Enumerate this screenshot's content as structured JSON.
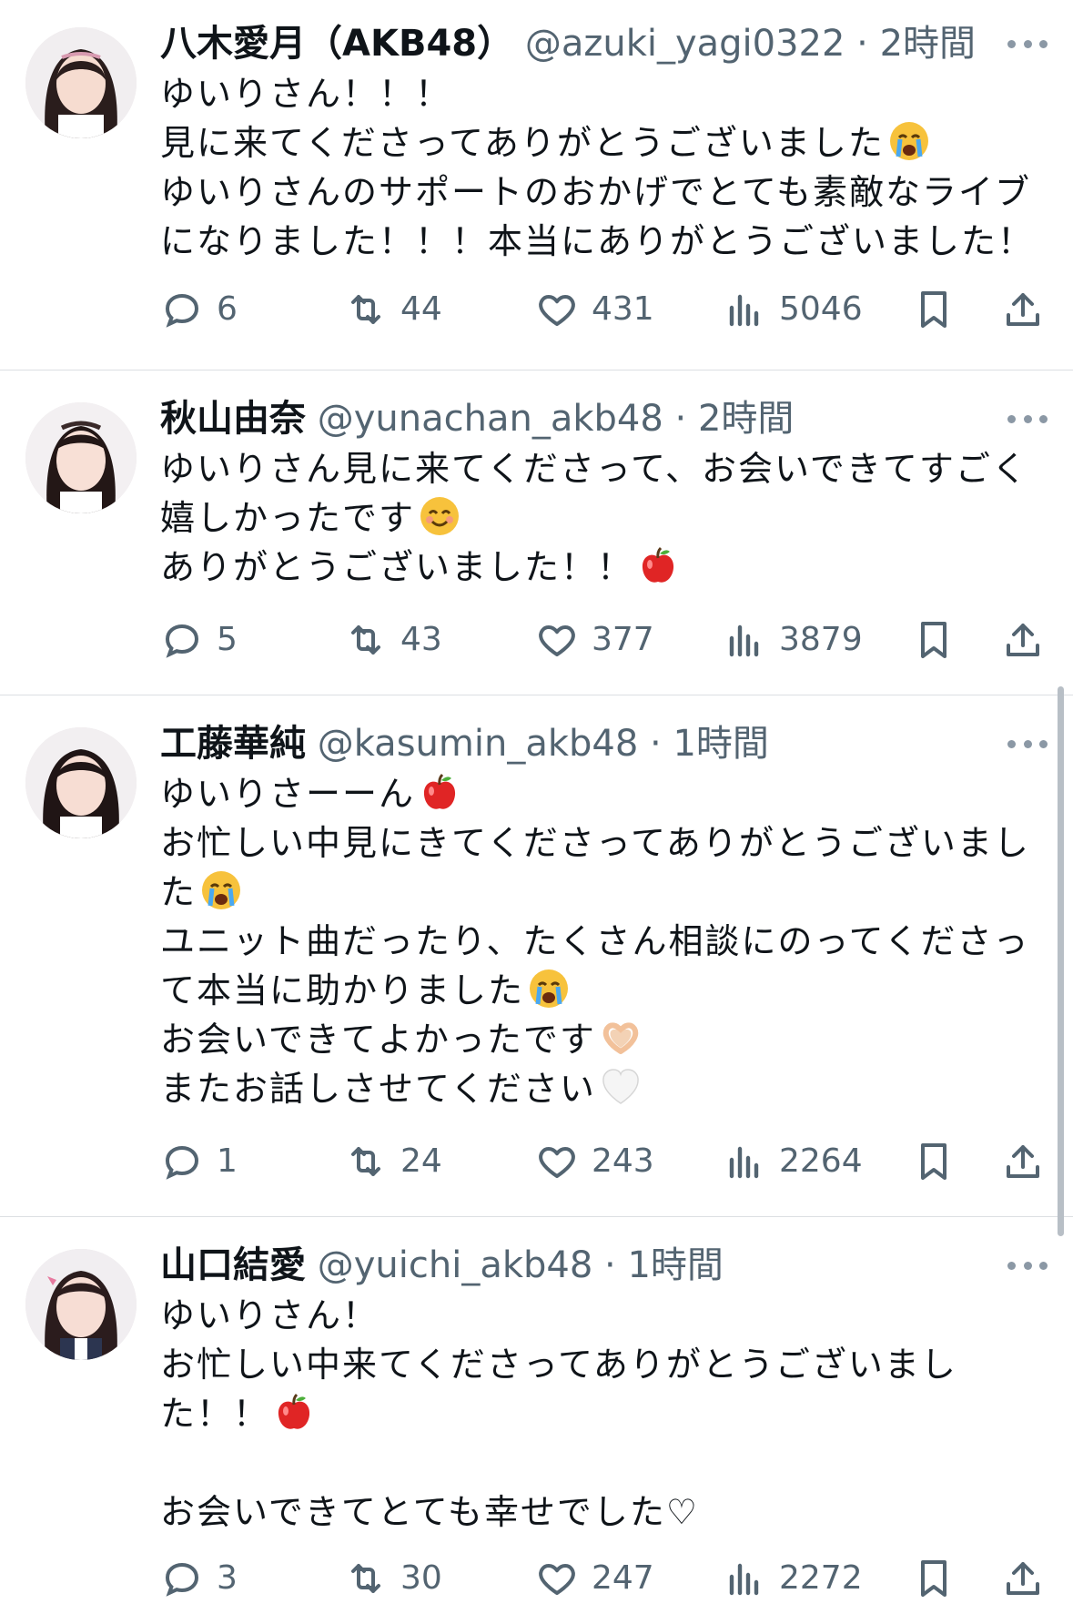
{
  "tweets": [
    {
      "name": "八木愛月（AKB48）",
      "handle": "@azuki_yagi0322",
      "time": "2時間",
      "lines": [
        "ゆいりさん！！！",
        "見に来てくださってありがとうございました",
        "ゆいりさんのサポートのおかげでとても素敵なライブ",
        "になりました！！！本当にありがとうございました！"
      ],
      "emojis": [
        "crying-face",
        "",
        "",
        ""
      ],
      "replies": "6",
      "retweets": "44",
      "likes": "431",
      "views": "5046"
    },
    {
      "name": "秋山由奈",
      "handle": "@yunachan_akb48",
      "time": "2時間",
      "lines": [
        "ゆいりさん見に来てくださって、お会いできてすごく",
        "嬉しかったです",
        "ありがとうございました！！"
      ],
      "emojis": [
        "",
        "smiling-face",
        "red-apple"
      ],
      "replies": "5",
      "retweets": "43",
      "likes": "377",
      "views": "3879"
    },
    {
      "name": "工藤華純",
      "handle": "@kasumin_akb48",
      "time": "1時間",
      "lines": [
        "ゆいりさーーん",
        "お忙しい中見にきてくださってありがとうございまし",
        "た",
        "ユニット曲だったり、たくさん相談にのってくださっ",
        "て本当に助かりました",
        "お会いできてよかったです",
        "またお話しさせてください"
      ],
      "emojis": [
        "red-apple",
        "",
        "crying-face",
        "",
        "crying-face",
        "heart-hands",
        "white-heart"
      ],
      "replies": "1",
      "retweets": "24",
      "likes": "243",
      "views": "2264"
    },
    {
      "name": "山口結愛",
      "handle": "@yuichi_akb48",
      "time": "1時間",
      "lines": [
        "ゆいりさん！",
        "お忙しい中来てくださってありがとうございまし",
        "た！！",
        "",
        "お会いできてとても幸せでした♡"
      ],
      "emojis": [
        "",
        "",
        "red-apple",
        "",
        ""
      ],
      "replies": "3",
      "retweets": "30",
      "likes": "247",
      "views": "2272"
    }
  ],
  "dot": "·"
}
